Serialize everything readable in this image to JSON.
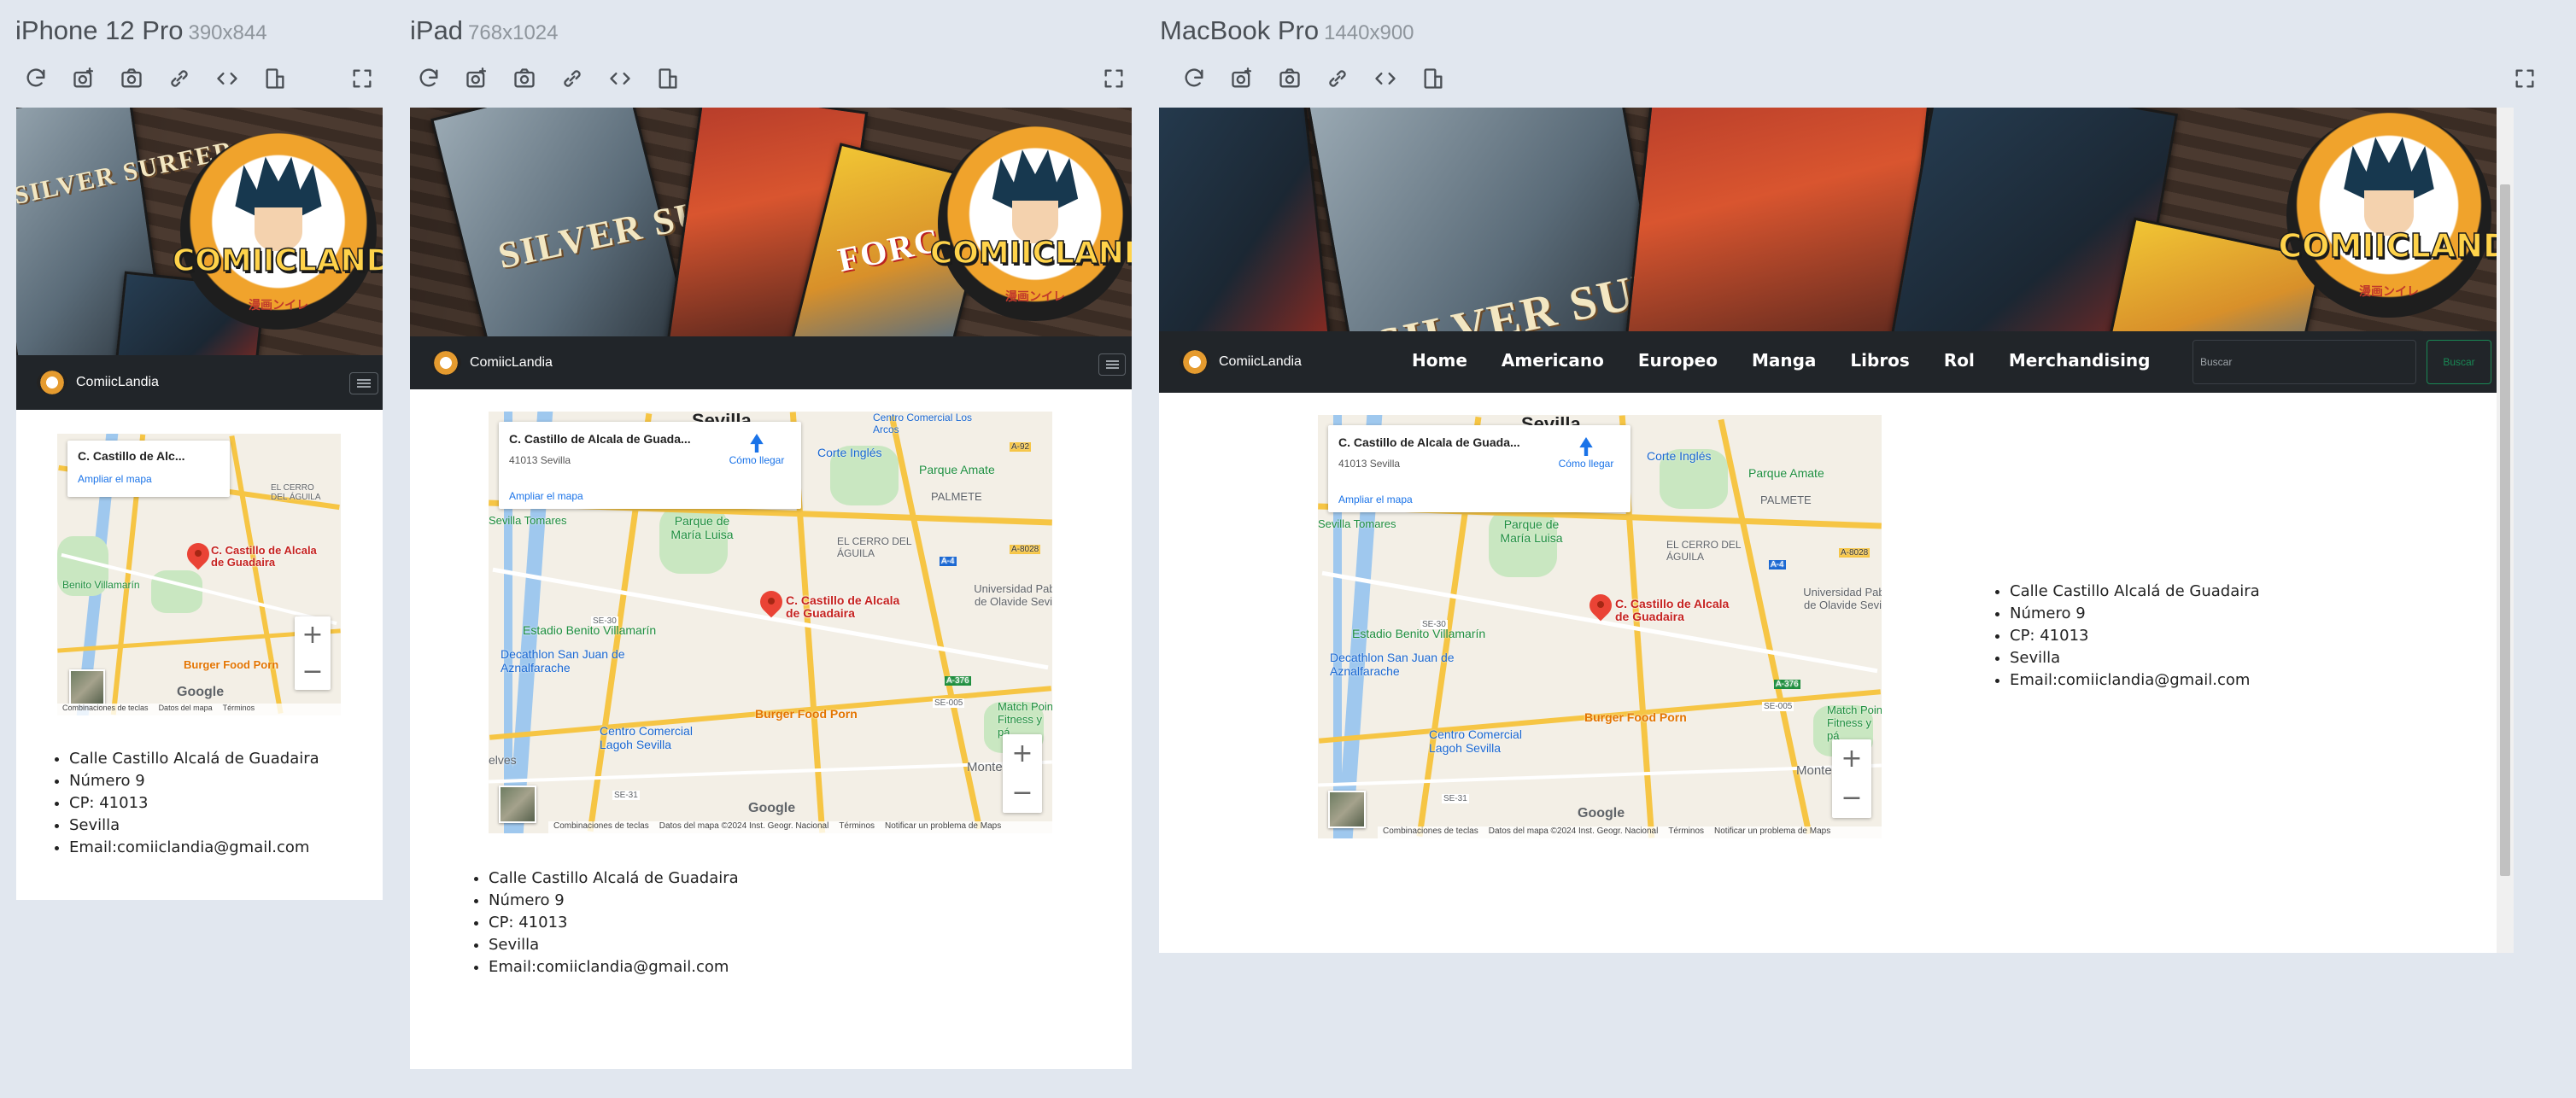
{
  "devices": [
    {
      "name": "iPhone 12 Pro",
      "dims": "390x844"
    },
    {
      "name": "iPad",
      "dims": "768x1024"
    },
    {
      "name": "MacBook Pro",
      "dims": "1440x900"
    }
  ],
  "site": {
    "hero_logo_text": "COMIICLANDIA",
    "hero_logo_sub": "漫画ンイレ",
    "comic_title_1": "SILVER SURFER",
    "comic_title_2": "FORCE",
    "brand": "ComiicLandia",
    "nav": [
      "Home",
      "Americano",
      "Europeo",
      "Manga",
      "Libros",
      "Rol",
      "Merchandising"
    ],
    "search_placeholder": "Buscar",
    "search_button": "Buscar"
  },
  "map": {
    "place_short": "C. Castillo de Alc...",
    "place_mid": "C. Castillo de Alcala de Guada...",
    "address": "41013 Sevilla",
    "directions": "Cómo llegar",
    "enlarge": "Ampliar el mapa",
    "pin_label": "C. Castillo de Alcala de Guadaira",
    "city_label": "Sevilla",
    "labels": {
      "cerro_aguila": "EL CERRO DEL ÁGUILA",
      "palmete": "PALMETE",
      "parque_maria_luisa": "Parque de María Luisa",
      "parque_amate": "Parque Amate",
      "corte_ingles": "Corte Inglés",
      "centro_los_arcos": "Centro Comercial Los Arcos",
      "estadio": "Estadio Benito Villamarín",
      "decathlon": "Decathlon San Juan de Aznalfarache",
      "burger": "Burger Food Porn",
      "olavide": "Universidad Pablo de Olavide Sevilla",
      "centro_lagoh": "Centro Comercial Lagoh Sevilla",
      "match_point": "Match Point Fitness y pá",
      "montequinto": "Monte",
      "tomares": "Sevilla Tomares",
      "cerro_short": "EL CERRO DEL ÁGUILA",
      "benito_short": "Benito Villamarín",
      "dos_hermanas": "elves",
      "road_se30": "SE-30",
      "road_a4": "A-4",
      "road_a376": "A-376",
      "road_se31": "SE-31",
      "road_a8028": "A-8028",
      "road_se005": "SE-005",
      "road_a92": "A-92"
    },
    "zoom_in": "+",
    "zoom_out": "−",
    "google": "Google",
    "attr_short": [
      "Combinaciones de teclas",
      "Datos del mapa",
      "Términos"
    ],
    "attr_long": [
      "Combinaciones de teclas",
      "Datos del mapa ©2024 Inst. Geogr. Nacional",
      "Términos",
      "Notificar un problema de Maps"
    ]
  },
  "info": [
    "Calle Castillo Alcalá de Guadaira",
    "Número 9",
    "CP: 41013",
    "Sevilla",
    "Email:comiiclandia@gmail.com"
  ],
  "toolbar_icons": [
    "refresh-icon",
    "camera-screenshot-icon",
    "camera-icon",
    "link-icon",
    "code-icon",
    "rotate-device-icon",
    "fullscreen-icon"
  ]
}
